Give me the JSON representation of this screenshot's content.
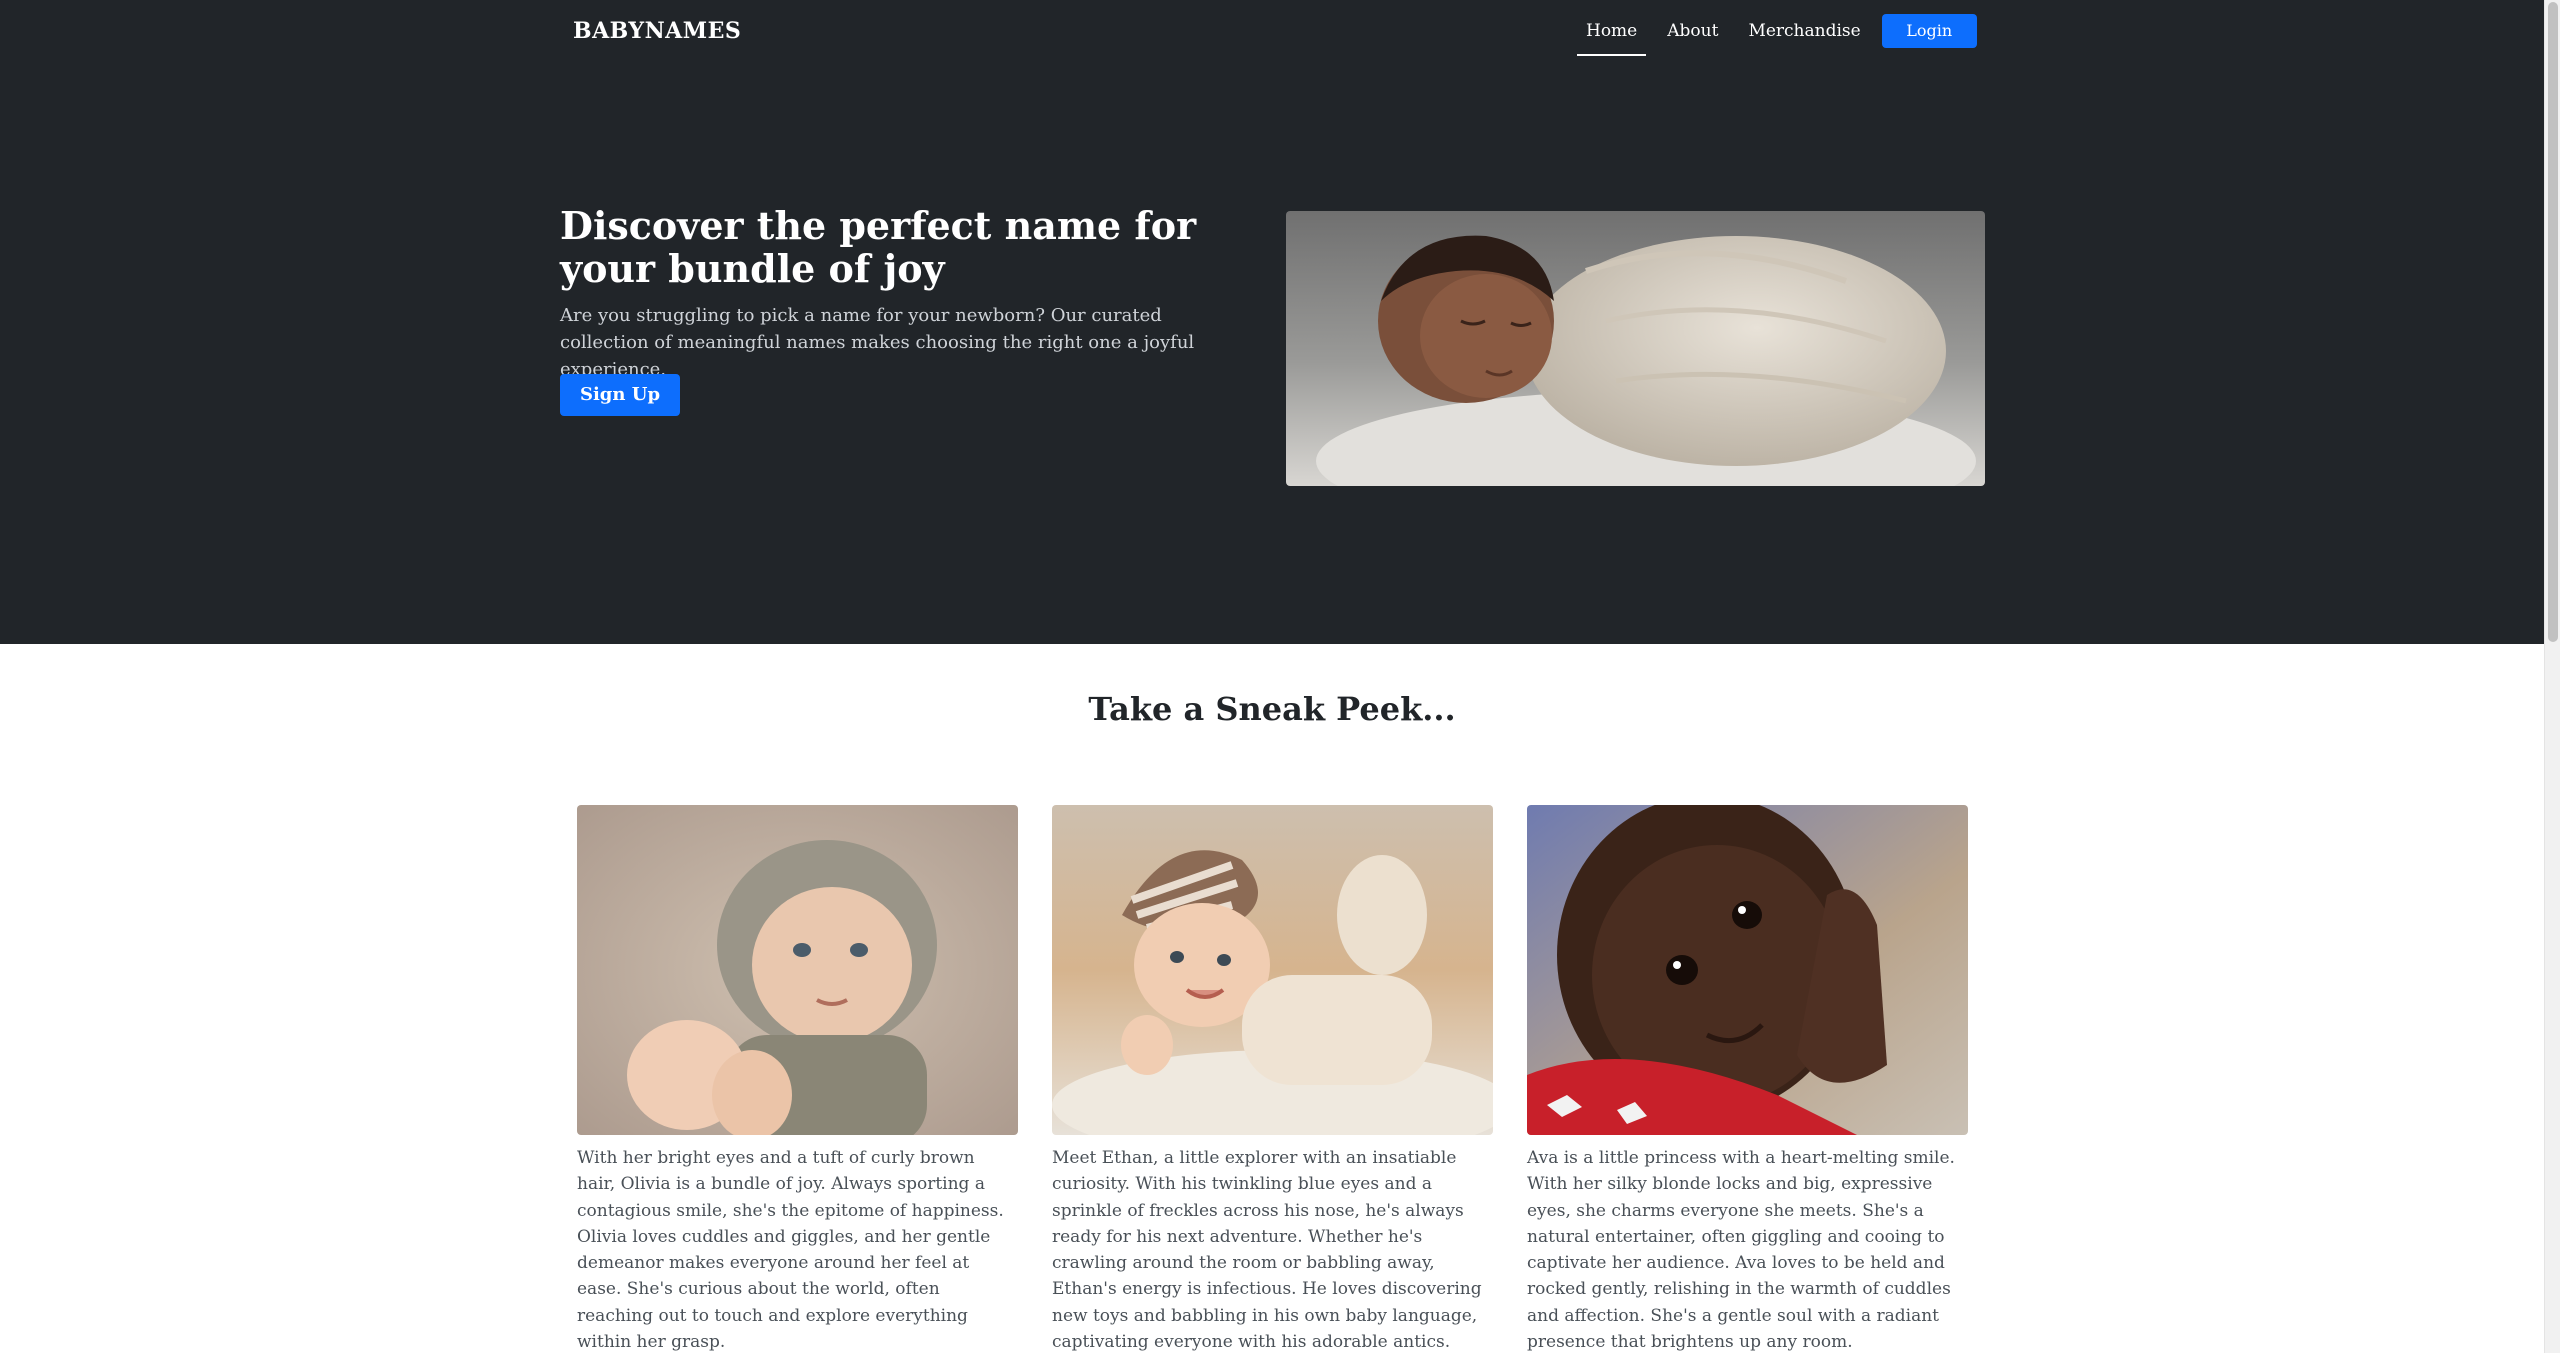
{
  "nav": {
    "brand": "BABYNAMES",
    "links": [
      "Home",
      "About",
      "Merchandise"
    ],
    "login": "Login"
  },
  "hero": {
    "title": "Discover the perfect name for your bundle of joy",
    "subtitle": "Are you struggling to pick a name for your newborn? Our curated collection of meaningful names makes choosing the right one a joyful experience.",
    "signup": "Sign Up"
  },
  "peek": {
    "title": "Take a Sneak Peek...",
    "cards": [
      {
        "text": "With her bright eyes and a tuft of curly brown hair, Olivia is a bundle of joy. Always sporting a contagious smile, she's the epitome of happiness. Olivia loves cuddles and giggles, and her gentle demeanor makes everyone around her feel at ease. She's curious about the world, often reaching out to touch and explore everything within her grasp."
      },
      {
        "text": "Meet Ethan, a little explorer with an insatiable curiosity. With his twinkling blue eyes and a sprinkle of freckles across his nose, he's always ready for his next adventure. Whether he's crawling around the room or babbling away, Ethan's energy is infectious. He loves discovering new toys and babbling in his own baby language, captivating everyone with his adorable antics."
      },
      {
        "text": "Ava is a little princess with a heart-melting smile. With her silky blonde locks and big, expressive eyes, she charms everyone she meets. She's a natural entertainer, often giggling and cooing to captivate her audience. Ava loves to be held and rocked gently, relishing in the warmth of cuddles and affection. She's a gentle soul with a radiant presence that brightens up any room."
      }
    ]
  },
  "colors": {
    "hero_bg": "#212529",
    "primary": "#0d6efd"
  }
}
